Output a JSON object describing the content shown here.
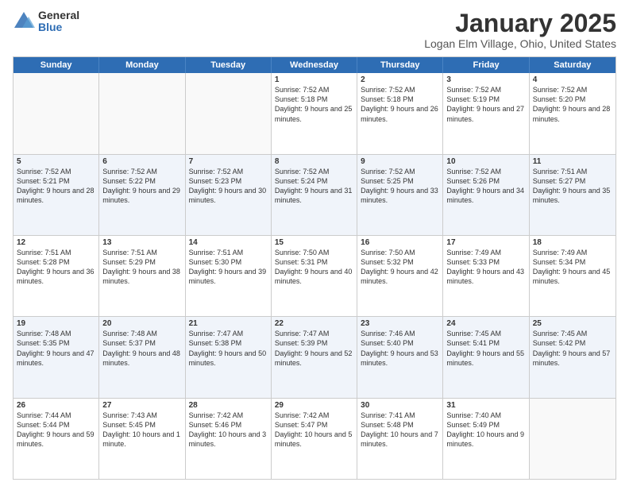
{
  "logo": {
    "general": "General",
    "blue": "Blue"
  },
  "header": {
    "month": "January 2025",
    "location": "Logan Elm Village, Ohio, United States"
  },
  "weekdays": [
    "Sunday",
    "Monday",
    "Tuesday",
    "Wednesday",
    "Thursday",
    "Friday",
    "Saturday"
  ],
  "weeks": [
    [
      {
        "day": "",
        "info": ""
      },
      {
        "day": "",
        "info": ""
      },
      {
        "day": "",
        "info": ""
      },
      {
        "day": "1",
        "info": "Sunrise: 7:52 AM\nSunset: 5:18 PM\nDaylight: 9 hours and 25 minutes."
      },
      {
        "day": "2",
        "info": "Sunrise: 7:52 AM\nSunset: 5:18 PM\nDaylight: 9 hours and 26 minutes."
      },
      {
        "day": "3",
        "info": "Sunrise: 7:52 AM\nSunset: 5:19 PM\nDaylight: 9 hours and 27 minutes."
      },
      {
        "day": "4",
        "info": "Sunrise: 7:52 AM\nSunset: 5:20 PM\nDaylight: 9 hours and 28 minutes."
      }
    ],
    [
      {
        "day": "5",
        "info": "Sunrise: 7:52 AM\nSunset: 5:21 PM\nDaylight: 9 hours and 28 minutes."
      },
      {
        "day": "6",
        "info": "Sunrise: 7:52 AM\nSunset: 5:22 PM\nDaylight: 9 hours and 29 minutes."
      },
      {
        "day": "7",
        "info": "Sunrise: 7:52 AM\nSunset: 5:23 PM\nDaylight: 9 hours and 30 minutes."
      },
      {
        "day": "8",
        "info": "Sunrise: 7:52 AM\nSunset: 5:24 PM\nDaylight: 9 hours and 31 minutes."
      },
      {
        "day": "9",
        "info": "Sunrise: 7:52 AM\nSunset: 5:25 PM\nDaylight: 9 hours and 33 minutes."
      },
      {
        "day": "10",
        "info": "Sunrise: 7:52 AM\nSunset: 5:26 PM\nDaylight: 9 hours and 34 minutes."
      },
      {
        "day": "11",
        "info": "Sunrise: 7:51 AM\nSunset: 5:27 PM\nDaylight: 9 hours and 35 minutes."
      }
    ],
    [
      {
        "day": "12",
        "info": "Sunrise: 7:51 AM\nSunset: 5:28 PM\nDaylight: 9 hours and 36 minutes."
      },
      {
        "day": "13",
        "info": "Sunrise: 7:51 AM\nSunset: 5:29 PM\nDaylight: 9 hours and 38 minutes."
      },
      {
        "day": "14",
        "info": "Sunrise: 7:51 AM\nSunset: 5:30 PM\nDaylight: 9 hours and 39 minutes."
      },
      {
        "day": "15",
        "info": "Sunrise: 7:50 AM\nSunset: 5:31 PM\nDaylight: 9 hours and 40 minutes."
      },
      {
        "day": "16",
        "info": "Sunrise: 7:50 AM\nSunset: 5:32 PM\nDaylight: 9 hours and 42 minutes."
      },
      {
        "day": "17",
        "info": "Sunrise: 7:49 AM\nSunset: 5:33 PM\nDaylight: 9 hours and 43 minutes."
      },
      {
        "day": "18",
        "info": "Sunrise: 7:49 AM\nSunset: 5:34 PM\nDaylight: 9 hours and 45 minutes."
      }
    ],
    [
      {
        "day": "19",
        "info": "Sunrise: 7:48 AM\nSunset: 5:35 PM\nDaylight: 9 hours and 47 minutes."
      },
      {
        "day": "20",
        "info": "Sunrise: 7:48 AM\nSunset: 5:37 PM\nDaylight: 9 hours and 48 minutes."
      },
      {
        "day": "21",
        "info": "Sunrise: 7:47 AM\nSunset: 5:38 PM\nDaylight: 9 hours and 50 minutes."
      },
      {
        "day": "22",
        "info": "Sunrise: 7:47 AM\nSunset: 5:39 PM\nDaylight: 9 hours and 52 minutes."
      },
      {
        "day": "23",
        "info": "Sunrise: 7:46 AM\nSunset: 5:40 PM\nDaylight: 9 hours and 53 minutes."
      },
      {
        "day": "24",
        "info": "Sunrise: 7:45 AM\nSunset: 5:41 PM\nDaylight: 9 hours and 55 minutes."
      },
      {
        "day": "25",
        "info": "Sunrise: 7:45 AM\nSunset: 5:42 PM\nDaylight: 9 hours and 57 minutes."
      }
    ],
    [
      {
        "day": "26",
        "info": "Sunrise: 7:44 AM\nSunset: 5:44 PM\nDaylight: 9 hours and 59 minutes."
      },
      {
        "day": "27",
        "info": "Sunrise: 7:43 AM\nSunset: 5:45 PM\nDaylight: 10 hours and 1 minute."
      },
      {
        "day": "28",
        "info": "Sunrise: 7:42 AM\nSunset: 5:46 PM\nDaylight: 10 hours and 3 minutes."
      },
      {
        "day": "29",
        "info": "Sunrise: 7:42 AM\nSunset: 5:47 PM\nDaylight: 10 hours and 5 minutes."
      },
      {
        "day": "30",
        "info": "Sunrise: 7:41 AM\nSunset: 5:48 PM\nDaylight: 10 hours and 7 minutes."
      },
      {
        "day": "31",
        "info": "Sunrise: 7:40 AM\nSunset: 5:49 PM\nDaylight: 10 hours and 9 minutes."
      },
      {
        "day": "",
        "info": ""
      }
    ]
  ]
}
